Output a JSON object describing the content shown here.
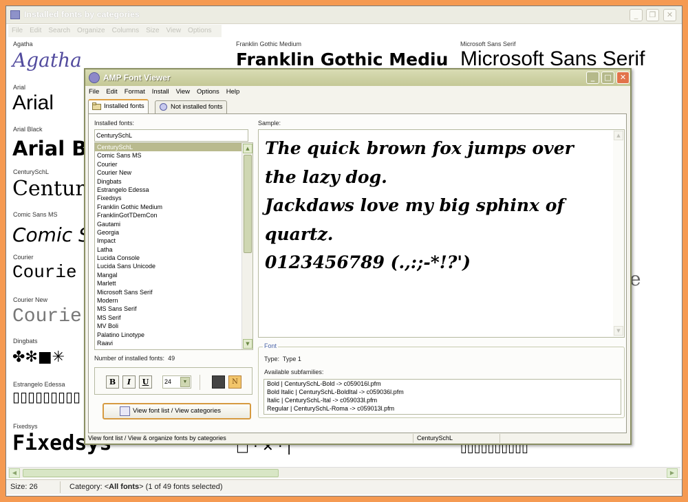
{
  "back_window": {
    "title": "Installed fonts by categories",
    "controls": [
      "_",
      "❐",
      "✕"
    ],
    "menu": [
      "File",
      "Edit",
      "Search",
      "Organize",
      "Columns",
      "Size",
      "View",
      "Options"
    ],
    "font_previews": [
      {
        "label": "Agatha",
        "sample": "Agatha"
      },
      {
        "label": "Arial",
        "sample": "Arial"
      },
      {
        "label": "Arial Black",
        "sample": "Arial B"
      },
      {
        "label": "CenturySchL",
        "sample": "Centur"
      },
      {
        "label": "Comic Sans MS",
        "sample": "Comic S"
      },
      {
        "label": "Courier",
        "sample": "Courie"
      },
      {
        "label": "Courier New",
        "sample": "Courie"
      },
      {
        "label": "Dingbats",
        "sample": "✤✻■✳"
      },
      {
        "label": "Estrangelo Edessa",
        "sample": "▯▯▯▯▯▯▯▯▯"
      },
      {
        "label": "Fixedsys",
        "sample": "Fixedsys"
      }
    ],
    "col2_label": "Franklin Gothic Medium",
    "col2_sample": "Franklin Gothic Mediu",
    "col3_label": "Microsoft Sans Serif",
    "col3_sample": "Microsoft Sans Serif",
    "col3_partial": "e",
    "bottom_col2_glyphs": "□ · ✕ · |",
    "bottom_col3_glyphs": "▯▯▯▯▯▯▯▯▯▯",
    "status": {
      "size": "Size: 26",
      "category_prefix": "Category: <",
      "category_value": "All fonts",
      "category_suffix": ">  (1 of 49 fonts selected)"
    }
  },
  "front_window": {
    "title": "AMP Font Viewer",
    "menu": [
      "File",
      "Edit",
      "Format",
      "Install",
      "View",
      "Options",
      "Help"
    ],
    "tabs": [
      {
        "label": "Installed fonts",
        "active": true
      },
      {
        "label": "Not installed fonts",
        "active": false
      }
    ],
    "installed_label": "Installed fonts:",
    "search_value": "CenturySchL",
    "fonts": [
      "CenturySchL",
      "Comic Sans MS",
      "Courier",
      "Courier New",
      "Dingbats",
      "Estrangelo Edessa",
      "Fixedsys",
      "Franklin Gothic Medium",
      "FranklinGotTDemCon",
      "Gautami",
      "Georgia",
      "Impact",
      "Latha",
      "Lucida Console",
      "Lucida Sans Unicode",
      "Mangal",
      "Marlett",
      "Microsoft Sans Serif",
      "Modern",
      "MS Sans Serif",
      "MS Serif",
      "MV Boli",
      "Palatino Linotype",
      "Raavi"
    ],
    "selected_font": "CenturySchL",
    "count_label": "Number of installed fonts:",
    "count_value": "49",
    "format_buttons": {
      "bold": "B",
      "italic": "I",
      "underline": "U"
    },
    "size_value": "24",
    "view_button_label": "View font list / View categories",
    "sample_label": "Sample:",
    "sample_lines": [
      "The quick brown fox jumps over",
      "the lazy dog.",
      "Jackdaws love my big sphinx of",
      "quartz.",
      "0123456789 (.,:;-*!?')"
    ],
    "font_group_label": "Font",
    "type_label": "Type:",
    "type_value": "Type 1",
    "subfamilies_label": "Available subfamilies:",
    "subfamilies": [
      "Bold  |  CenturySchL-Bold  ->  c059016l.pfm",
      "Bold Italic  |  CenturySchL-BoldItal  ->  c059036l.pfm",
      "Italic  |  CenturySchL-Ital  ->  c059033l.pfm",
      "Regular  |  CenturySchL-Roma  ->  c059013l.pfm"
    ],
    "status_left": "View font list / View & organize fonts by categories",
    "status_right": "CenturySchL"
  },
  "colors": {
    "outer_frame": "#f59a52",
    "front_title": "#c4c896",
    "selection": "#b9ba8e",
    "close_button": "#e2734a"
  }
}
